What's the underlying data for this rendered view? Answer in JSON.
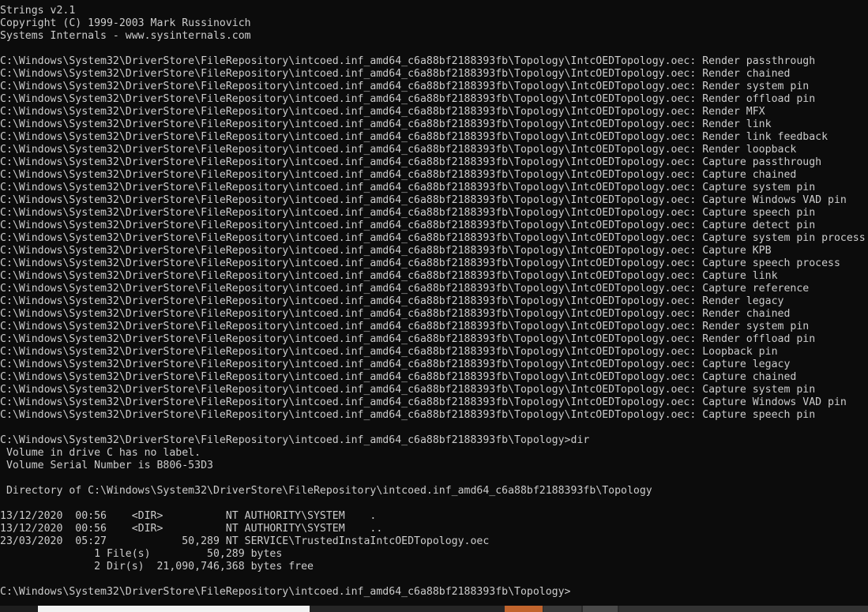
{
  "console": {
    "lines": [
      "Strings v2.1",
      "Copyright (C) 1999-2003 Mark Russinovich",
      "Systems Internals - www.sysinternals.com",
      "",
      "C:\\Windows\\System32\\DriverStore\\FileRepository\\intcoed.inf_amd64_c6a88bf2188393fb\\Topology\\IntcOEDTopology.oec: Render passthrough",
      "C:\\Windows\\System32\\DriverStore\\FileRepository\\intcoed.inf_amd64_c6a88bf2188393fb\\Topology\\IntcOEDTopology.oec: Render chained",
      "C:\\Windows\\System32\\DriverStore\\FileRepository\\intcoed.inf_amd64_c6a88bf2188393fb\\Topology\\IntcOEDTopology.oec: Render system pin",
      "C:\\Windows\\System32\\DriverStore\\FileRepository\\intcoed.inf_amd64_c6a88bf2188393fb\\Topology\\IntcOEDTopology.oec: Render offload pin",
      "C:\\Windows\\System32\\DriverStore\\FileRepository\\intcoed.inf_amd64_c6a88bf2188393fb\\Topology\\IntcOEDTopology.oec: Render MFX",
      "C:\\Windows\\System32\\DriverStore\\FileRepository\\intcoed.inf_amd64_c6a88bf2188393fb\\Topology\\IntcOEDTopology.oec: Render link",
      "C:\\Windows\\System32\\DriverStore\\FileRepository\\intcoed.inf_amd64_c6a88bf2188393fb\\Topology\\IntcOEDTopology.oec: Render link feedback",
      "C:\\Windows\\System32\\DriverStore\\FileRepository\\intcoed.inf_amd64_c6a88bf2188393fb\\Topology\\IntcOEDTopology.oec: Render loopback",
      "C:\\Windows\\System32\\DriverStore\\FileRepository\\intcoed.inf_amd64_c6a88bf2188393fb\\Topology\\IntcOEDTopology.oec: Capture passthrough",
      "C:\\Windows\\System32\\DriverStore\\FileRepository\\intcoed.inf_amd64_c6a88bf2188393fb\\Topology\\IntcOEDTopology.oec: Capture chained",
      "C:\\Windows\\System32\\DriverStore\\FileRepository\\intcoed.inf_amd64_c6a88bf2188393fb\\Topology\\IntcOEDTopology.oec: Capture system pin",
      "C:\\Windows\\System32\\DriverStore\\FileRepository\\intcoed.inf_amd64_c6a88bf2188393fb\\Topology\\IntcOEDTopology.oec: Capture Windows VAD pin",
      "C:\\Windows\\System32\\DriverStore\\FileRepository\\intcoed.inf_amd64_c6a88bf2188393fb\\Topology\\IntcOEDTopology.oec: Capture speech pin",
      "C:\\Windows\\System32\\DriverStore\\FileRepository\\intcoed.inf_amd64_c6a88bf2188393fb\\Topology\\IntcOEDTopology.oec: Capture detect pin",
      "C:\\Windows\\System32\\DriverStore\\FileRepository\\intcoed.inf_amd64_c6a88bf2188393fb\\Topology\\IntcOEDTopology.oec: Capture system pin process",
      "C:\\Windows\\System32\\DriverStore\\FileRepository\\intcoed.inf_amd64_c6a88bf2188393fb\\Topology\\IntcOEDTopology.oec: Capture KPB",
      "C:\\Windows\\System32\\DriverStore\\FileRepository\\intcoed.inf_amd64_c6a88bf2188393fb\\Topology\\IntcOEDTopology.oec: Capture speech process",
      "C:\\Windows\\System32\\DriverStore\\FileRepository\\intcoed.inf_amd64_c6a88bf2188393fb\\Topology\\IntcOEDTopology.oec: Capture link",
      "C:\\Windows\\System32\\DriverStore\\FileRepository\\intcoed.inf_amd64_c6a88bf2188393fb\\Topology\\IntcOEDTopology.oec: Capture reference",
      "C:\\Windows\\System32\\DriverStore\\FileRepository\\intcoed.inf_amd64_c6a88bf2188393fb\\Topology\\IntcOEDTopology.oec: Render legacy",
      "C:\\Windows\\System32\\DriverStore\\FileRepository\\intcoed.inf_amd64_c6a88bf2188393fb\\Topology\\IntcOEDTopology.oec: Render chained",
      "C:\\Windows\\System32\\DriverStore\\FileRepository\\intcoed.inf_amd64_c6a88bf2188393fb\\Topology\\IntcOEDTopology.oec: Render system pin",
      "C:\\Windows\\System32\\DriverStore\\FileRepository\\intcoed.inf_amd64_c6a88bf2188393fb\\Topology\\IntcOEDTopology.oec: Render offload pin",
      "C:\\Windows\\System32\\DriverStore\\FileRepository\\intcoed.inf_amd64_c6a88bf2188393fb\\Topology\\IntcOEDTopology.oec: Loopback pin",
      "C:\\Windows\\System32\\DriverStore\\FileRepository\\intcoed.inf_amd64_c6a88bf2188393fb\\Topology\\IntcOEDTopology.oec: Capture legacy",
      "C:\\Windows\\System32\\DriverStore\\FileRepository\\intcoed.inf_amd64_c6a88bf2188393fb\\Topology\\IntcOEDTopology.oec: Capture chained",
      "C:\\Windows\\System32\\DriverStore\\FileRepository\\intcoed.inf_amd64_c6a88bf2188393fb\\Topology\\IntcOEDTopology.oec: Capture system pin",
      "C:\\Windows\\System32\\DriverStore\\FileRepository\\intcoed.inf_amd64_c6a88bf2188393fb\\Topology\\IntcOEDTopology.oec: Capture Windows VAD pin",
      "C:\\Windows\\System32\\DriverStore\\FileRepository\\intcoed.inf_amd64_c6a88bf2188393fb\\Topology\\IntcOEDTopology.oec: Capture speech pin",
      "",
      "C:\\Windows\\System32\\DriverStore\\FileRepository\\intcoed.inf_amd64_c6a88bf2188393fb\\Topology>dir",
      " Volume in drive C has no label.",
      " Volume Serial Number is B806-53D3",
      "",
      " Directory of C:\\Windows\\System32\\DriverStore\\FileRepository\\intcoed.inf_amd64_c6a88bf2188393fb\\Topology",
      "",
      "13/12/2020  00:56    <DIR>          NT AUTHORITY\\SYSTEM    .",
      "13/12/2020  00:56    <DIR>          NT AUTHORITY\\SYSTEM    ..",
      "23/03/2020  05:27            50,289 NT SERVICE\\TrustedInstaIntcOEDTopology.oec",
      "               1 File(s)         50,289 bytes",
      "               2 Dir(s)  21,090,746,368 bytes free",
      "",
      "C:\\Windows\\System32\\DriverStore\\FileRepository\\intcoed.inf_amd64_c6a88bf2188393fb\\Topology>"
    ]
  },
  "colors": {
    "background": "#0c0c0c",
    "text": "#cccccc",
    "taskbar_accent": "#c1642d"
  }
}
